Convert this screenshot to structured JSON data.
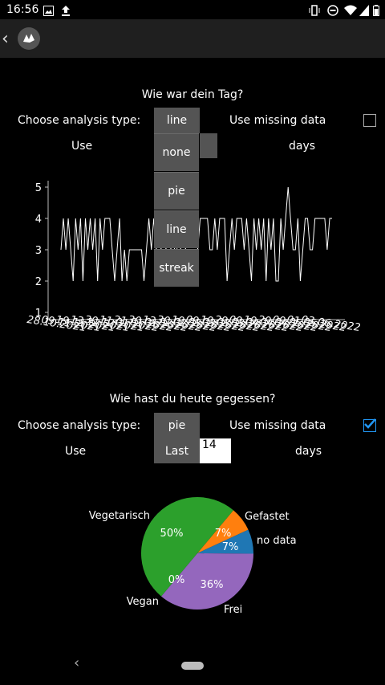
{
  "statusbar": {
    "time": "16:56"
  },
  "section1": {
    "title": "Wie war dein Tag?",
    "analysis_label": "Choose analysis type:",
    "analysis_value": "line",
    "missing_label": "Use missing data",
    "use_label": "Use",
    "days_label": "days",
    "use_missing_checked": false,
    "dropdown_options": [
      "none",
      "pie",
      "line",
      "streak"
    ]
  },
  "section2": {
    "title": "Wie hast du heute gegessen?",
    "analysis_label": "Choose analysis type:",
    "analysis_value": "pie",
    "missing_label": "Use missing data",
    "use_label": "Use",
    "range_value": "Last",
    "days_input": "14",
    "days_label": "days",
    "use_missing_checked": true
  },
  "chart_data": [
    {
      "type": "line",
      "ylim": [
        1,
        5
      ],
      "yticks": [
        "1",
        "2",
        "3",
        "4",
        "5"
      ],
      "x_tick_labels": [
        "28.10.2021",
        "09.11.2021",
        "19.11.2021",
        "13.12.2021",
        "30.12.2021",
        "11.01.2022",
        "21.01.2022",
        "30.01.2022",
        "13.02.2022",
        "30.02.2022",
        "19.03.2022",
        "09.03.2022",
        "19.03.2022",
        "29.03.2022",
        "09.04.2022",
        "19.04.2022",
        "29.04.2022",
        "09.05.2022",
        "01.05.2022",
        "03.06.2022"
      ],
      "values": [
        3,
        4,
        3,
        4,
        3,
        2,
        4,
        3,
        4,
        2,
        4,
        3,
        4,
        3,
        4,
        2,
        4,
        3,
        4,
        4,
        4,
        3,
        2,
        3,
        4,
        2,
        3,
        2,
        3,
        3,
        3,
        3,
        3,
        3,
        2,
        3,
        4,
        3,
        4,
        3,
        4,
        3,
        4,
        3,
        4,
        3,
        4,
        2,
        4,
        3,
        4,
        3,
        4,
        4,
        4,
        4,
        3,
        4,
        4,
        4,
        4,
        3,
        3,
        4,
        3,
        4,
        4,
        4,
        2,
        3,
        4,
        3,
        4,
        4,
        4,
        3,
        4,
        3,
        2,
        4,
        3,
        4,
        3,
        4,
        2,
        4,
        3,
        4,
        2,
        2,
        4,
        3,
        4,
        5,
        4,
        3,
        3,
        4,
        2,
        3,
        4,
        4,
        3,
        3,
        4,
        4,
        4,
        4,
        4,
        3,
        4,
        4
      ]
    },
    {
      "type": "pie",
      "slices": [
        {
          "label": "Gefastet",
          "value": 7,
          "pct_label": "7%",
          "color": "#ff7f0e"
        },
        {
          "label": "no data",
          "value": 7,
          "pct_label": "7%",
          "color": "#1f77b4"
        },
        {
          "label": "Frei",
          "value": 36,
          "pct_label": "36%",
          "color": "#9467bd"
        },
        {
          "label": "Vegan",
          "value": 0,
          "pct_label": "0%",
          "color": "#d62728"
        },
        {
          "label": "Vegetarisch",
          "value": 50,
          "pct_label": "50%",
          "color": "#2ca02c"
        }
      ]
    }
  ]
}
